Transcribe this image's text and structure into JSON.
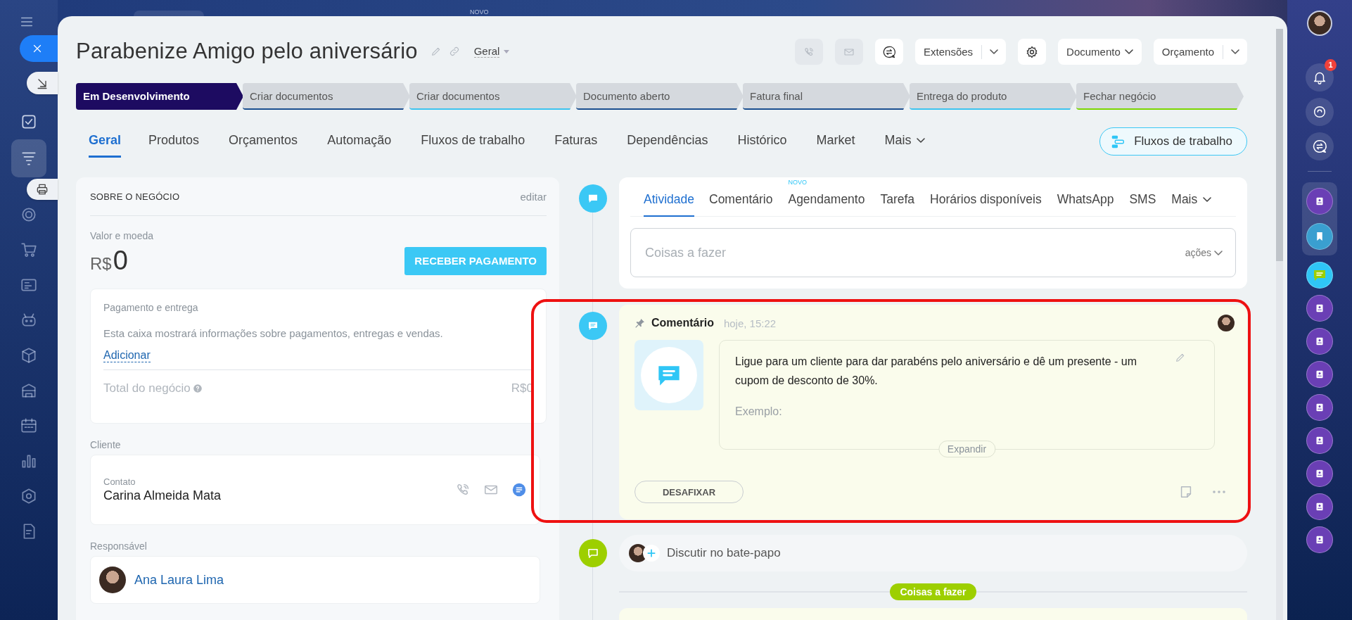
{
  "top_bar": {
    "badge": "NOVO"
  },
  "left_rail": {
    "items": [
      {
        "selected": false
      },
      {
        "selected": true
      },
      {
        "selected": false
      },
      {
        "selected": false
      },
      {
        "selected": false
      },
      {
        "selected": false
      },
      {
        "selected": false
      },
      {
        "selected": false
      },
      {
        "selected": false
      },
      {
        "selected": false
      },
      {
        "selected": false
      },
      {
        "selected": false
      }
    ]
  },
  "header": {
    "title": "Parabenize Amigo pelo aniversário",
    "category": "Geral",
    "call_button": {
      "disabled": true
    },
    "mail_button": {
      "disabled": true
    },
    "extensions_button": "Extensões",
    "document_button": "Documento",
    "budget_button": "Orçamento"
  },
  "stages": [
    {
      "label": "Em Desenvolvimento",
      "selected": true,
      "color": "#1d0b61"
    },
    {
      "label": "Criar documentos",
      "selected": false,
      "color": "#1b4f8f"
    },
    {
      "label": "Criar documentos",
      "selected": false,
      "color": "#3cc3ef"
    },
    {
      "label": "Documento aberto",
      "selected": false,
      "color": "#1b4f8f"
    },
    {
      "label": "Fatura final",
      "selected": false,
      "color": "#1b4f8f"
    },
    {
      "label": "Entrega do produto",
      "selected": false,
      "color": "#3cc3ef"
    },
    {
      "label": "Fechar negócio",
      "selected": false,
      "color": "#7bd500"
    }
  ],
  "tabs": [
    {
      "label": "Geral",
      "selected": true,
      "kind": "tab"
    },
    {
      "label": "Produtos",
      "selected": false,
      "kind": "tab"
    },
    {
      "label": "Orçamentos",
      "selected": false,
      "kind": "tab"
    },
    {
      "label": "Automação",
      "selected": false,
      "kind": "tab"
    },
    {
      "label": "Fluxos de trabalho",
      "selected": false,
      "kind": "tab"
    },
    {
      "label": "Faturas",
      "selected": false,
      "kind": "tab"
    },
    {
      "label": "Dependências",
      "selected": false,
      "kind": "tab"
    },
    {
      "label": "Histórico",
      "selected": false,
      "kind": "tab"
    },
    {
      "label": "Market",
      "selected": false,
      "kind": "tab"
    },
    {
      "label": "Mais",
      "selected": false,
      "kind": "more"
    }
  ],
  "workflow_button": "Fluxos de trabalho",
  "about": {
    "heading": "SOBRE O NEGÓCIO",
    "edit": "editar",
    "value_label": "Valor e moeda",
    "currency": "R$",
    "amount": "0",
    "pay_button": "RECEBER PAGAMENTO",
    "payment": {
      "title": "Pagamento e entrega",
      "description": "Esta caixa mostrará informações sobre pagamentos, entregas e vendas.",
      "add_link": "Adicionar",
      "total_label": "Total do negócio",
      "total_value": "R$0"
    },
    "client_label": "Cliente",
    "contact_label": "Contato",
    "contact_name": "Carina Almeida Mata",
    "responsible_label": "Responsável",
    "responsible_name": "Ana Laura Lima"
  },
  "activity": {
    "tabs": [
      {
        "label": "Atividade",
        "selected": true,
        "kind": "tab"
      },
      {
        "label": "Comentário",
        "selected": false,
        "kind": "tab"
      },
      {
        "label": "Agendamento",
        "selected": false,
        "kind": "tab",
        "badge": "NOVO"
      },
      {
        "label": "Tarefa",
        "selected": false,
        "kind": "tab"
      },
      {
        "label": "Horários disponíveis",
        "selected": false,
        "kind": "tab"
      },
      {
        "label": "WhatsApp",
        "selected": false,
        "kind": "tab"
      },
      {
        "label": "SMS",
        "selected": false,
        "kind": "tab"
      },
      {
        "label": "Mais",
        "selected": false,
        "kind": "more"
      }
    ],
    "placeholder": "Coisas a fazer",
    "actions": "ações"
  },
  "comment": {
    "title": "Comentário",
    "time": "hoje, 15:22",
    "pinned": true,
    "text": "Ligue para um cliente para dar parabéns pelo aniversário e dê um presente - um cupom de desconto de 30%.",
    "example": "Exemplo:",
    "expand": "Expandir",
    "unpin_button": "DESAFIXAR"
  },
  "chat": {
    "label": "Discutir no bate-papo"
  },
  "divider_pill": "Coisas a fazer",
  "right_rail": {
    "notification_count": "1"
  }
}
